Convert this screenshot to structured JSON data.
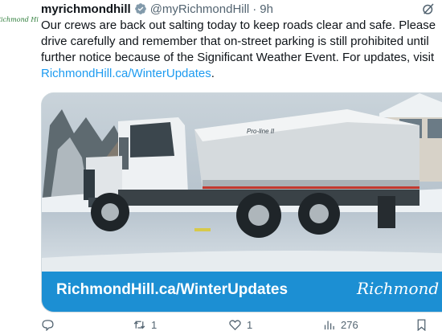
{
  "tweet": {
    "avatar_text": "Richmond Hill",
    "display_name": "myrichmondhill",
    "handle": "@myRichmondHill",
    "separator": "·",
    "time": "9h",
    "text_lines": [
      "Our crews are back out salting today to keep roads clear and safe. Please",
      "drive carefully and remember that on-street parking is still prohibited until",
      "further notice because of the Significant Weather Event. For updates, visit"
    ],
    "link_text": "RichmondHill.ca/WinterUpdates",
    "link_suffix": ".",
    "media": {
      "banner_text": "RichmondHill.ca/WinterUpdates",
      "banner_logo": "Richmond Hill",
      "truck_model": "Pro-line II"
    },
    "actions": {
      "replies": "",
      "retweets": "1",
      "likes": "1",
      "views": "276"
    }
  },
  "colors": {
    "link": "#1d9bf0",
    "banner": "#1c8fd3",
    "muted": "#536471",
    "verified": "#829aab"
  },
  "icons": [
    "verified-icon",
    "grok-icon",
    "reply-icon",
    "retweet-icon",
    "like-icon",
    "views-icon",
    "bookmark-icon"
  ]
}
